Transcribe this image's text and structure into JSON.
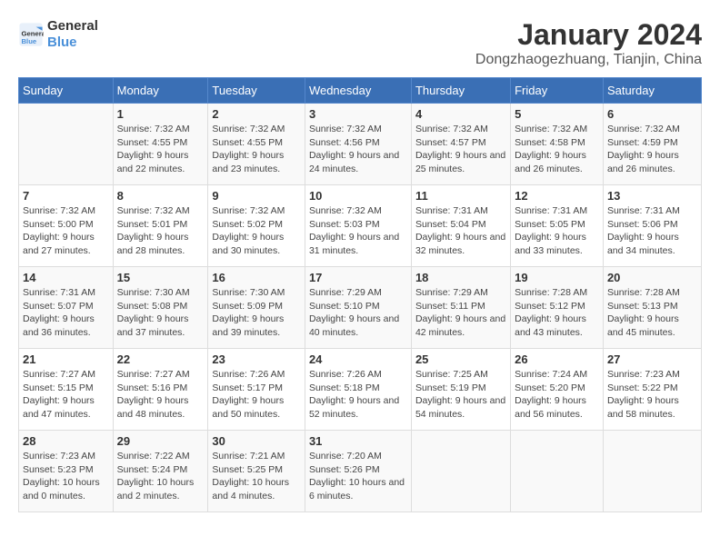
{
  "logo": {
    "text_general": "General",
    "text_blue": "Blue"
  },
  "title": "January 2024",
  "subtitle": "Dongzhaogezhuang, Tianjin, China",
  "weekdays": [
    "Sunday",
    "Monday",
    "Tuesday",
    "Wednesday",
    "Thursday",
    "Friday",
    "Saturday"
  ],
  "weeks": [
    [
      {
        "day": "",
        "sunrise": "",
        "sunset": "",
        "daylight": ""
      },
      {
        "day": "1",
        "sunrise": "7:32 AM",
        "sunset": "4:55 PM",
        "daylight": "9 hours and 22 minutes."
      },
      {
        "day": "2",
        "sunrise": "7:32 AM",
        "sunset": "4:55 PM",
        "daylight": "9 hours and 23 minutes."
      },
      {
        "day": "3",
        "sunrise": "7:32 AM",
        "sunset": "4:56 PM",
        "daylight": "9 hours and 24 minutes."
      },
      {
        "day": "4",
        "sunrise": "7:32 AM",
        "sunset": "4:57 PM",
        "daylight": "9 hours and 25 minutes."
      },
      {
        "day": "5",
        "sunrise": "7:32 AM",
        "sunset": "4:58 PM",
        "daylight": "9 hours and 26 minutes."
      },
      {
        "day": "6",
        "sunrise": "7:32 AM",
        "sunset": "4:59 PM",
        "daylight": "9 hours and 26 minutes."
      }
    ],
    [
      {
        "day": "7",
        "sunrise": "7:32 AM",
        "sunset": "5:00 PM",
        "daylight": "9 hours and 27 minutes."
      },
      {
        "day": "8",
        "sunrise": "7:32 AM",
        "sunset": "5:01 PM",
        "daylight": "9 hours and 28 minutes."
      },
      {
        "day": "9",
        "sunrise": "7:32 AM",
        "sunset": "5:02 PM",
        "daylight": "9 hours and 30 minutes."
      },
      {
        "day": "10",
        "sunrise": "7:32 AM",
        "sunset": "5:03 PM",
        "daylight": "9 hours and 31 minutes."
      },
      {
        "day": "11",
        "sunrise": "7:31 AM",
        "sunset": "5:04 PM",
        "daylight": "9 hours and 32 minutes."
      },
      {
        "day": "12",
        "sunrise": "7:31 AM",
        "sunset": "5:05 PM",
        "daylight": "9 hours and 33 minutes."
      },
      {
        "day": "13",
        "sunrise": "7:31 AM",
        "sunset": "5:06 PM",
        "daylight": "9 hours and 34 minutes."
      }
    ],
    [
      {
        "day": "14",
        "sunrise": "7:31 AM",
        "sunset": "5:07 PM",
        "daylight": "9 hours and 36 minutes."
      },
      {
        "day": "15",
        "sunrise": "7:30 AM",
        "sunset": "5:08 PM",
        "daylight": "9 hours and 37 minutes."
      },
      {
        "day": "16",
        "sunrise": "7:30 AM",
        "sunset": "5:09 PM",
        "daylight": "9 hours and 39 minutes."
      },
      {
        "day": "17",
        "sunrise": "7:29 AM",
        "sunset": "5:10 PM",
        "daylight": "9 hours and 40 minutes."
      },
      {
        "day": "18",
        "sunrise": "7:29 AM",
        "sunset": "5:11 PM",
        "daylight": "9 hours and 42 minutes."
      },
      {
        "day": "19",
        "sunrise": "7:28 AM",
        "sunset": "5:12 PM",
        "daylight": "9 hours and 43 minutes."
      },
      {
        "day": "20",
        "sunrise": "7:28 AM",
        "sunset": "5:13 PM",
        "daylight": "9 hours and 45 minutes."
      }
    ],
    [
      {
        "day": "21",
        "sunrise": "7:27 AM",
        "sunset": "5:15 PM",
        "daylight": "9 hours and 47 minutes."
      },
      {
        "day": "22",
        "sunrise": "7:27 AM",
        "sunset": "5:16 PM",
        "daylight": "9 hours and 48 minutes."
      },
      {
        "day": "23",
        "sunrise": "7:26 AM",
        "sunset": "5:17 PM",
        "daylight": "9 hours and 50 minutes."
      },
      {
        "day": "24",
        "sunrise": "7:26 AM",
        "sunset": "5:18 PM",
        "daylight": "9 hours and 52 minutes."
      },
      {
        "day": "25",
        "sunrise": "7:25 AM",
        "sunset": "5:19 PM",
        "daylight": "9 hours and 54 minutes."
      },
      {
        "day": "26",
        "sunrise": "7:24 AM",
        "sunset": "5:20 PM",
        "daylight": "9 hours and 56 minutes."
      },
      {
        "day": "27",
        "sunrise": "7:23 AM",
        "sunset": "5:22 PM",
        "daylight": "9 hours and 58 minutes."
      }
    ],
    [
      {
        "day": "28",
        "sunrise": "7:23 AM",
        "sunset": "5:23 PM",
        "daylight": "10 hours and 0 minutes."
      },
      {
        "day": "29",
        "sunrise": "7:22 AM",
        "sunset": "5:24 PM",
        "daylight": "10 hours and 2 minutes."
      },
      {
        "day": "30",
        "sunrise": "7:21 AM",
        "sunset": "5:25 PM",
        "daylight": "10 hours and 4 minutes."
      },
      {
        "day": "31",
        "sunrise": "7:20 AM",
        "sunset": "5:26 PM",
        "daylight": "10 hours and 6 minutes."
      },
      {
        "day": "",
        "sunrise": "",
        "sunset": "",
        "daylight": ""
      },
      {
        "day": "",
        "sunrise": "",
        "sunset": "",
        "daylight": ""
      },
      {
        "day": "",
        "sunrise": "",
        "sunset": "",
        "daylight": ""
      }
    ]
  ],
  "sunrise_label": "Sunrise:",
  "sunset_label": "Sunset:",
  "daylight_label": "Daylight:"
}
